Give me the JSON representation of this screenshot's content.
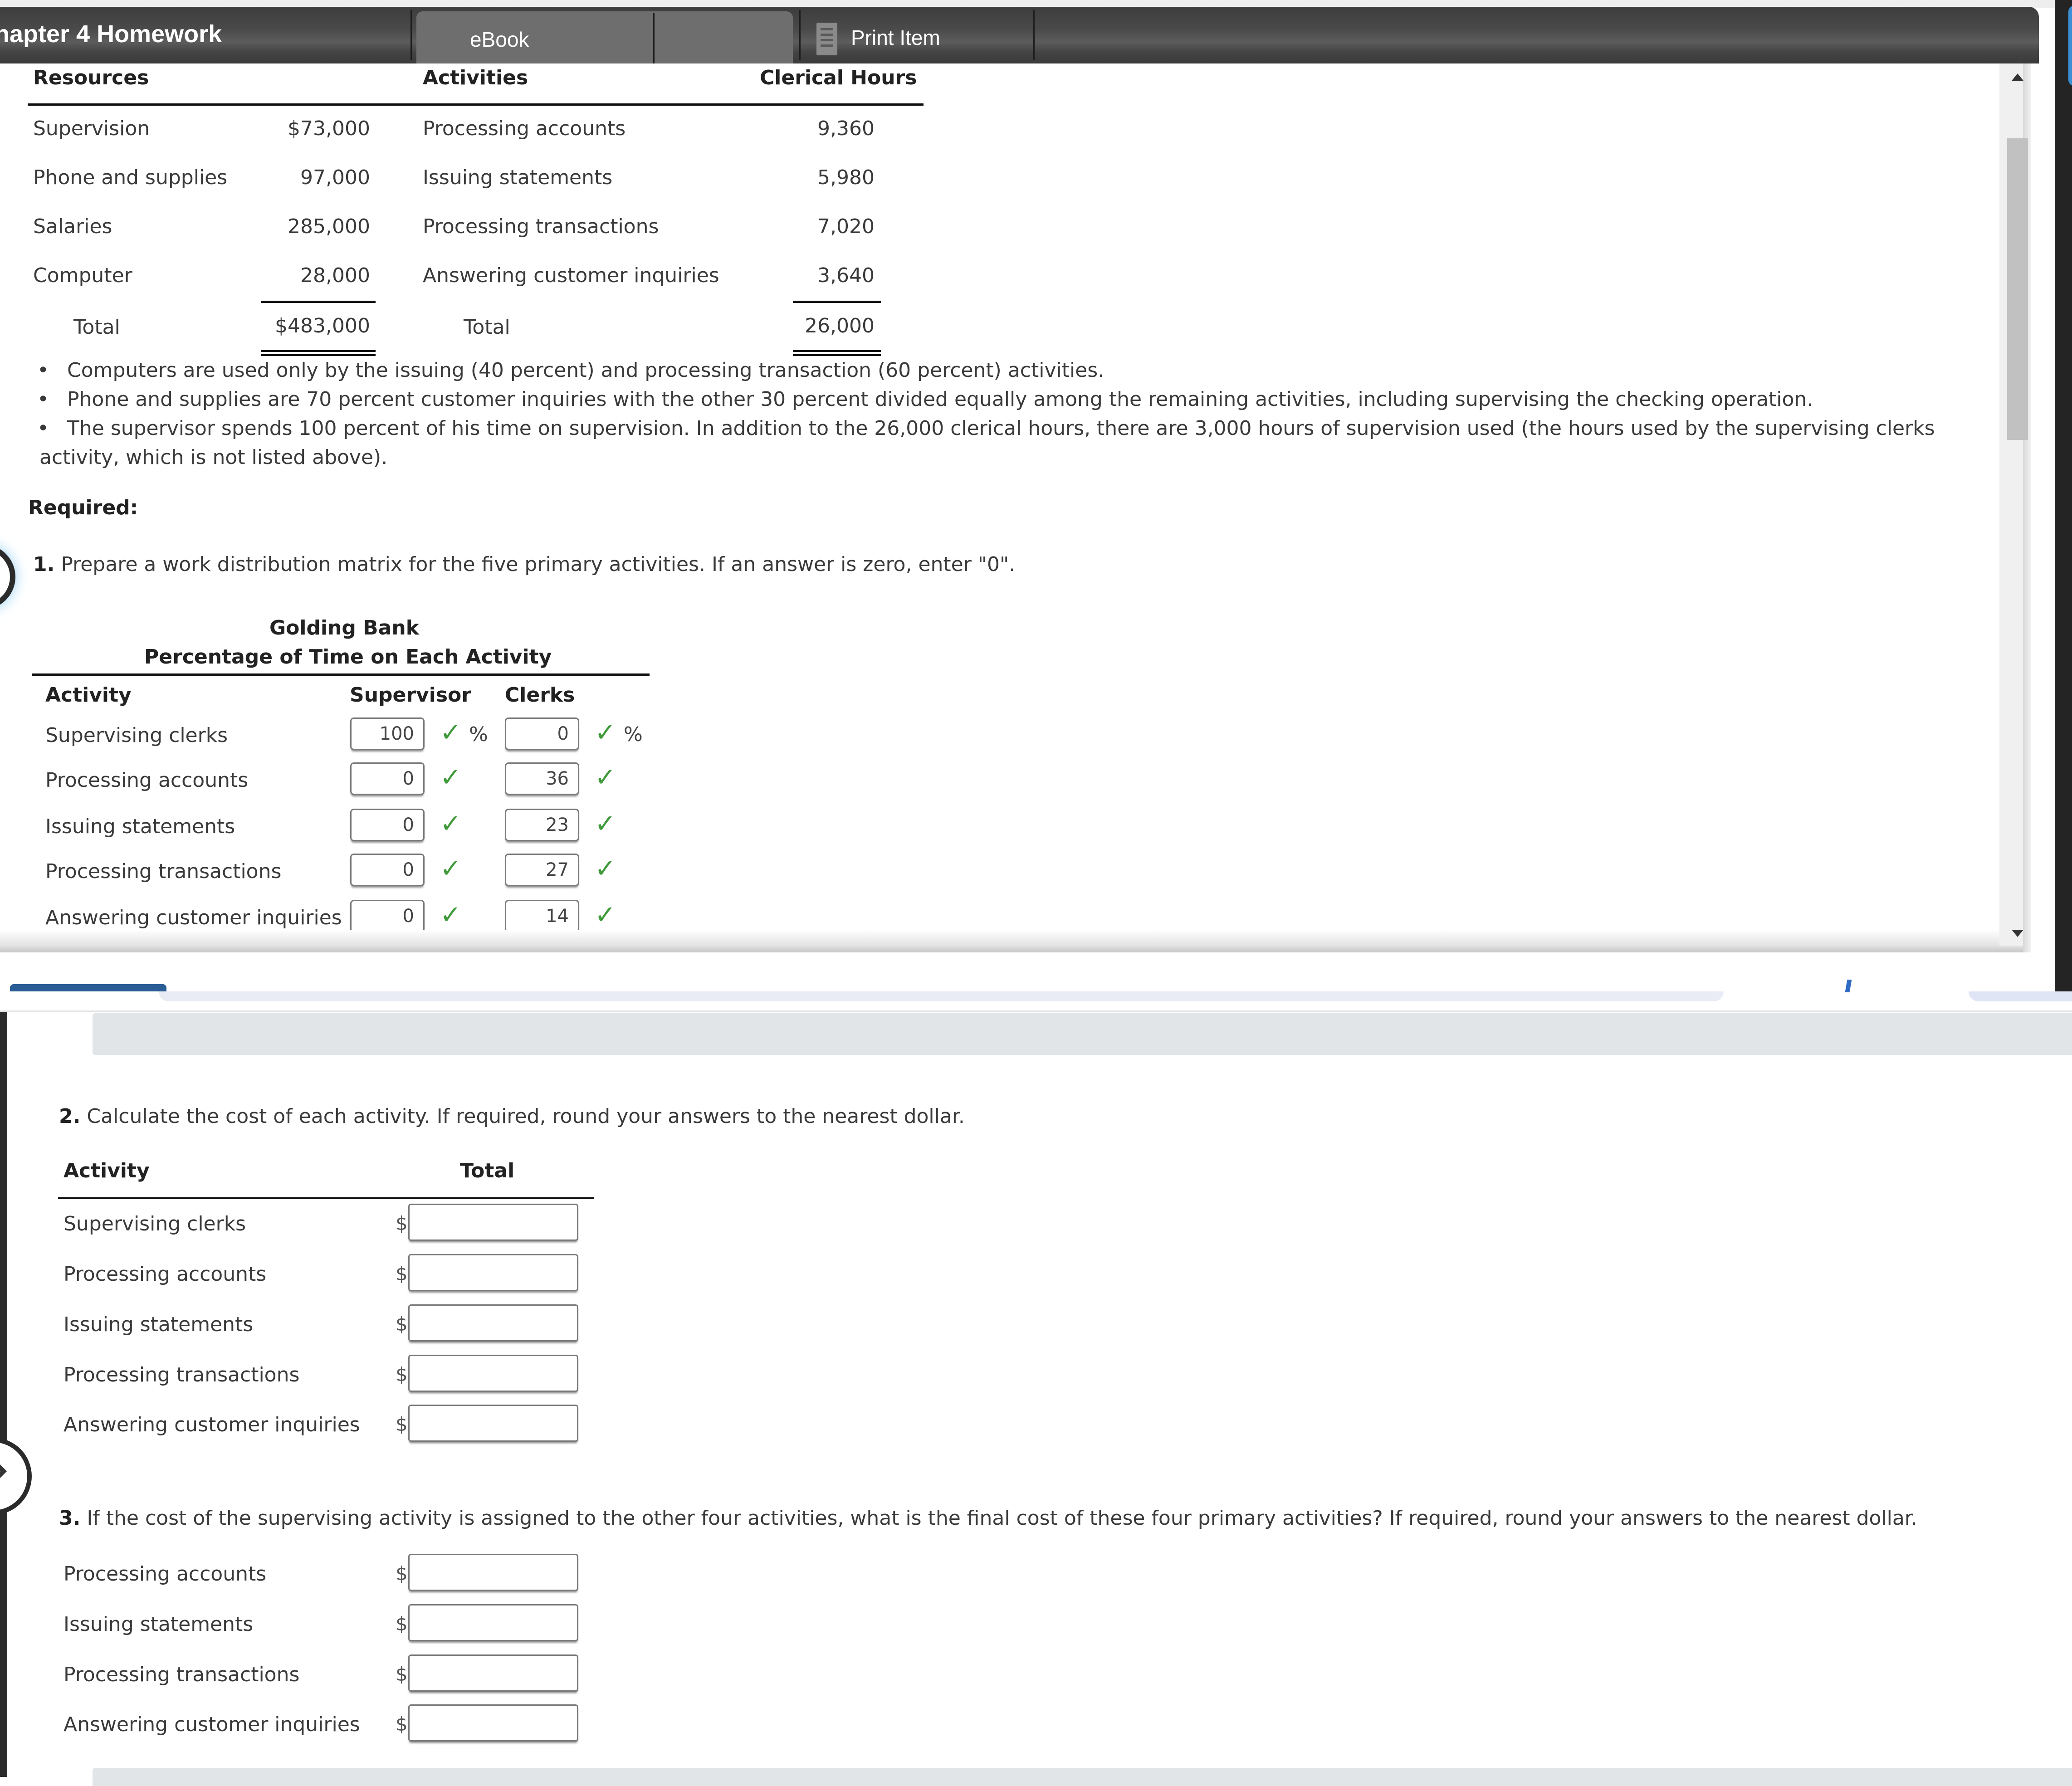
{
  "header": {
    "title": "hapter 4 Homework",
    "ebook_label": "eBook",
    "print_label": "Print Item"
  },
  "resources_table": {
    "headers": {
      "resources": "Resources",
      "activities": "Activities",
      "clerical_hours": "Clerical Hours"
    },
    "rows": [
      {
        "resource": "Supervision",
        "amount": "$73,000",
        "activity": "Processing accounts",
        "hours": "9,360"
      },
      {
        "resource": "Phone and supplies",
        "amount": "97,000",
        "activity": "Issuing statements",
        "hours": "5,980"
      },
      {
        "resource": "Salaries",
        "amount": "285,000",
        "activity": "Processing transactions",
        "hours": "7,020"
      },
      {
        "resource": "Computer",
        "amount": "28,000",
        "activity": "Answering customer inquiries",
        "hours": "3,640"
      }
    ],
    "total": {
      "resource_label": "Total",
      "amount": "$483,000",
      "activity_label": "Total",
      "hours": "26,000"
    }
  },
  "bullets": [
    "Computers are used only by the issuing (40 percent) and processing transaction (60 percent) activities.",
    "Phone and supplies are 70 percent customer inquiries with the other 30 percent divided equally among the remaining activities, including supervising the checking operation.",
    "The supervisor spends 100 percent of his time on supervision. In addition to the 26,000 clerical hours, there are 3,000 hours of supervision used (the hours used by the supervising clerks",
    "activity, which is not listed above)."
  ],
  "required_label": "Required:",
  "q1": {
    "number": "1.",
    "text": "Prepare a work distribution matrix for the five primary activities. If an answer is zero, enter \"0\".",
    "company": "Golding Bank",
    "subtitle": "Percentage of Time on Each Activity",
    "headers": {
      "activity": "Activity",
      "supervisor": "Supervisor",
      "clerks": "Clerks"
    },
    "percent_sign": "%",
    "check_glyph": "✓",
    "rows": [
      {
        "activity": "Supervising clerks",
        "supervisor": "100",
        "clerks": "0",
        "supervisor_correct": true,
        "clerks_correct": true
      },
      {
        "activity": "Processing accounts",
        "supervisor": "0",
        "clerks": "36",
        "supervisor_correct": true,
        "clerks_correct": true
      },
      {
        "activity": "Issuing statements",
        "supervisor": "0",
        "clerks": "23",
        "supervisor_correct": true,
        "clerks_correct": true
      },
      {
        "activity": "Processing transactions",
        "supervisor": "0",
        "clerks": "27",
        "supervisor_correct": true,
        "clerks_correct": true
      },
      {
        "activity": "Answering customer inquiries",
        "supervisor": "0",
        "clerks": "14",
        "supervisor_correct": true,
        "clerks_correct": true
      }
    ]
  },
  "q2": {
    "number": "2.",
    "text": "Calculate the cost of each activity. If required, round your answers to the nearest dollar.",
    "headers": {
      "activity": "Activity",
      "total": "Total"
    },
    "currency": "$",
    "rows": [
      {
        "activity": "Supervising clerks",
        "value": ""
      },
      {
        "activity": "Processing accounts",
        "value": ""
      },
      {
        "activity": "Issuing statements",
        "value": ""
      },
      {
        "activity": "Processing transactions",
        "value": ""
      },
      {
        "activity": "Answering customer inquiries",
        "value": ""
      }
    ]
  },
  "q3": {
    "number": "3.",
    "text": "If the cost of the supervising activity is assigned to the other four activities, what is the final cost of these four primary activities? If required, round your answers to the nearest dollar.",
    "currency": "$",
    "rows": [
      {
        "activity": "Processing accounts",
        "value": ""
      },
      {
        "activity": "Issuing statements",
        "value": ""
      },
      {
        "activity": "Processing transactions",
        "value": ""
      },
      {
        "activity": "Answering customer inquiries",
        "value": ""
      }
    ]
  },
  "colors": {
    "header_bg": "#4a4a4a",
    "tab_active": "#6e6e6e",
    "check_green": "#3f9a3a",
    "accent_blue": "#2a5c95"
  }
}
